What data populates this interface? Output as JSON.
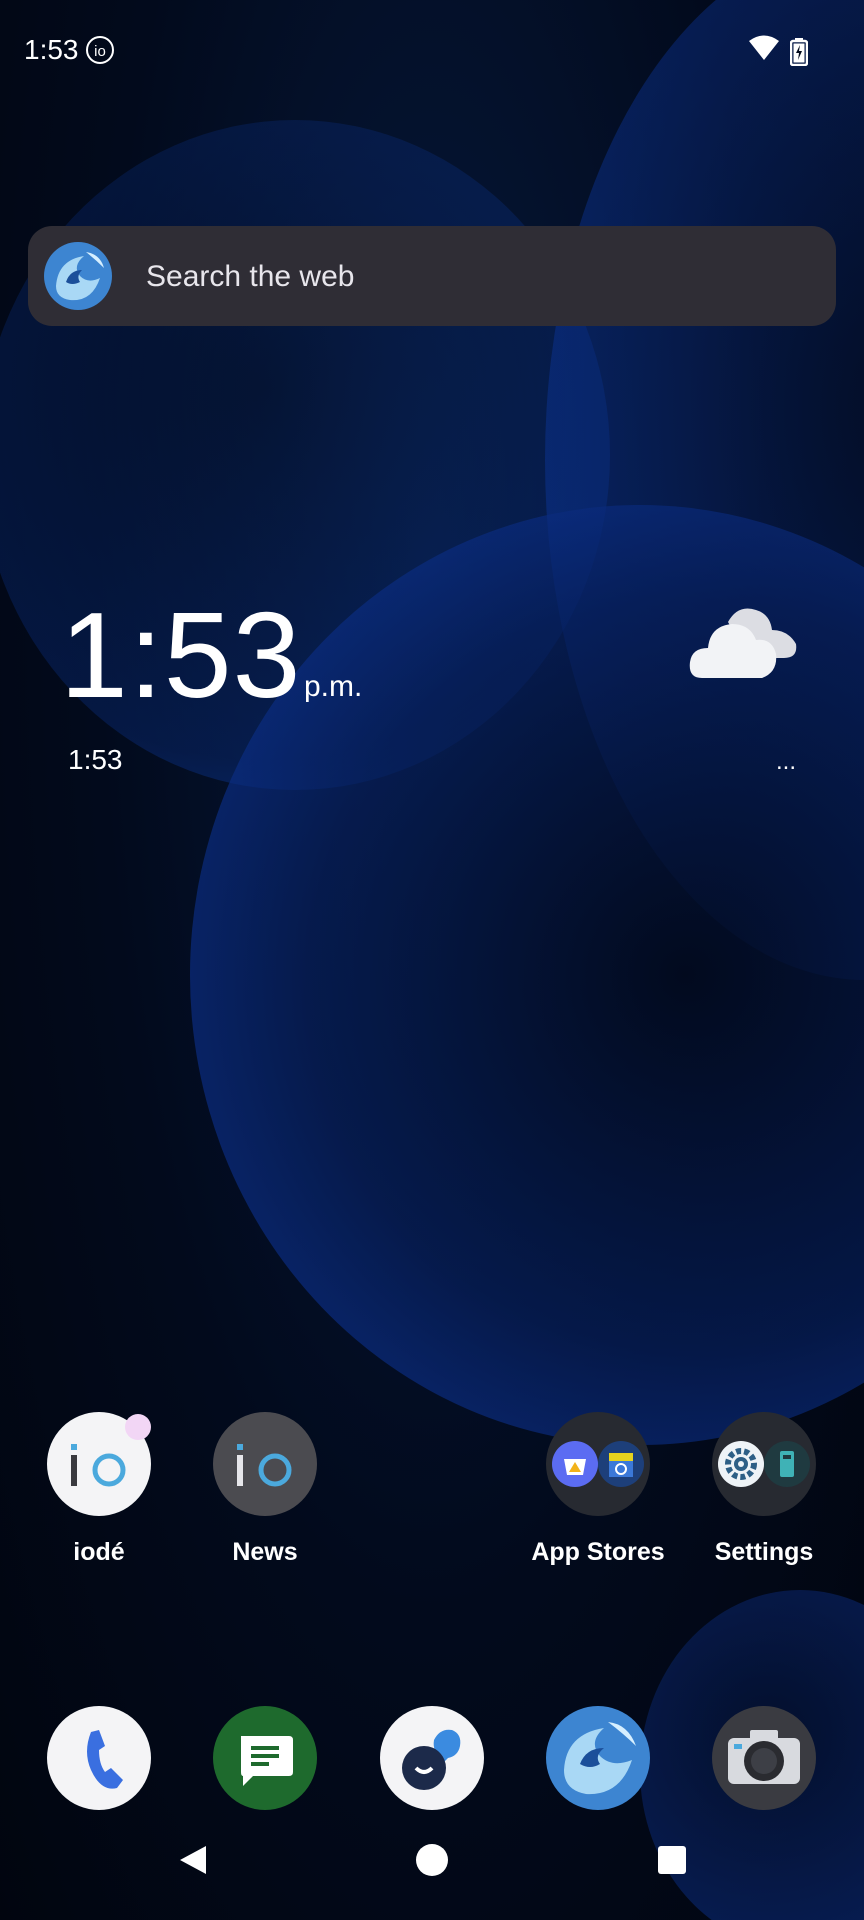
{
  "status_bar": {
    "time": "1:53",
    "io_badge": "io",
    "icons": [
      "wifi-icon",
      "battery-charging-icon"
    ]
  },
  "search": {
    "text": "Search the web",
    "logo": "iode-browser-logo"
  },
  "clock": {
    "time": "1:53",
    "ampm": "p.m.",
    "secondary_time": "1:53"
  },
  "weather": {
    "icon": "cloud-icon",
    "more": "..."
  },
  "apps": [
    {
      "label": "iodé",
      "icon": "iode-app-icon"
    },
    {
      "label": "News",
      "icon": "news-app-icon"
    },
    {
      "label": "App Stores",
      "icon": "app-stores-folder-icon"
    },
    {
      "label": "Settings",
      "icon": "settings-folder-icon"
    }
  ],
  "dock": [
    "phone-icon",
    "messages-icon",
    "chat-icon",
    "browser-icon",
    "camera-icon"
  ],
  "nav": [
    "back-button",
    "home-button",
    "recents-button"
  ],
  "colors": {
    "accent_blue": "#4ba9dd",
    "search_bg": "#2f2d35",
    "messages_green": "#1e6a2d"
  }
}
